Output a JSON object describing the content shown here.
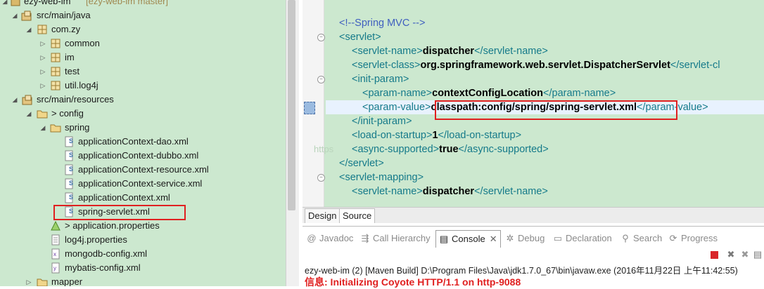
{
  "tree": {
    "rows": [
      {
        "label": "ezy-web-im",
        "decoration": "[ezy-web-im master]",
        "icon": "project-icon"
      },
      {
        "label": "src/main/java",
        "icon": "source-folder-icon"
      },
      {
        "label": "com.zy",
        "icon": "package-icon"
      },
      {
        "label": "common",
        "icon": "package-icon"
      },
      {
        "label": "im",
        "icon": "package-icon"
      },
      {
        "label": "test",
        "icon": "package-icon"
      },
      {
        "label": "util.log4j",
        "icon": "package-icon"
      },
      {
        "label": "src/main/resources",
        "icon": "source-folder-icon"
      },
      {
        "label": "> config",
        "icon": "folder-icon"
      },
      {
        "label": "spring",
        "icon": "folder-icon"
      },
      {
        "label": "applicationContext-dao.xml",
        "icon": "spring-xml-icon"
      },
      {
        "label": "applicationContext-dubbo.xml",
        "icon": "spring-xml-icon"
      },
      {
        "label": "applicationContext-resource.xml",
        "icon": "spring-xml-icon"
      },
      {
        "label": "applicationContext-service.xml",
        "icon": "spring-xml-icon"
      },
      {
        "label": "applicationContext.xml",
        "icon": "spring-xml-icon"
      },
      {
        "label": "spring-servlet.xml",
        "icon": "spring-xml-icon"
      },
      {
        "label": "> application.properties",
        "icon": "properties-icon"
      },
      {
        "label": "log4j.properties",
        "icon": "properties-icon"
      },
      {
        "label": "mongodb-config.xml",
        "icon": "xml-icon"
      },
      {
        "label": "mybatis-config.xml",
        "icon": "xml-icon"
      },
      {
        "label": "mapper",
        "icon": "folder-icon"
      }
    ]
  },
  "editor": {
    "lines": [
      {
        "comment": "<!--Spring MVC -->"
      },
      {
        "open": "<servlet>"
      },
      {
        "open": "<servlet-name>",
        "value": "dispatcher",
        "close": "</servlet-name>"
      },
      {
        "open": "<servlet-class>",
        "value": "org.springframework.web.servlet.DispatcherServlet",
        "close": "</servlet-cl"
      },
      {
        "open": "<init-param>"
      },
      {
        "open": "<param-name>",
        "value": "contextConfigLocation",
        "close": "</param-name>"
      },
      {
        "open": "<param-value>",
        "value": "classpath:config/spring/spring-servlet.xml",
        "close": "</param-value>"
      },
      {
        "open": "</init-param>"
      },
      {
        "open": "<load-on-startup>",
        "value": "1",
        "close": "</load-on-startup>"
      },
      {
        "open": "<async-supported>",
        "value": "true",
        "close": "</async-supported>"
      },
      {
        "open": "</servlet>"
      },
      {
        "open": "<servlet-mapping>"
      },
      {
        "open": "<servlet-name>",
        "value": "dispatcher",
        "close": "</servlet-name>"
      }
    ],
    "ghost_text": "https",
    "tabs": {
      "design": "Design",
      "source": "Source"
    }
  },
  "panel": {
    "tabs": {
      "javadoc": "Javadoc",
      "call_hierarchy": "Call Hierarchy",
      "console": "Console",
      "debug": "Debug",
      "declaration": "Declaration",
      "search": "Search",
      "progress": "Progress"
    },
    "console_header": "ezy-web-im (2) [Maven Build] D:\\Program Files\\Java\\jdk1.7.0_67\\bin\\javaw.exe (2016年11月22日 上午11:42:55)",
    "console_output": "信息: Initializing Coyote HTTP/1.1 on http-9088"
  },
  "colors": {
    "editor_bg": "#cce8cf",
    "tag": "#157a8a",
    "comment": "#3f5fbf",
    "highlight_box": "#e02020"
  }
}
